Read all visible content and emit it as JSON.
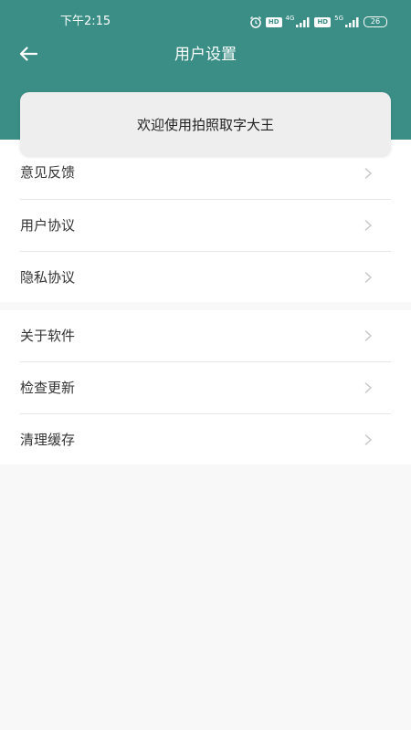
{
  "status_bar": {
    "time": "下午2:15",
    "network_4g": "4G",
    "network_5g": "5G",
    "hd_badge": "HD",
    "battery": "26",
    "icons": [
      "alarm-icon",
      "hd-icon",
      "signal-icon",
      "battery-icon"
    ]
  },
  "header": {
    "title": "用户设置",
    "back_icon": "back-arrow-icon",
    "background_color": "#3a8e86"
  },
  "welcome": {
    "text": "欢迎使用拍照取字大王"
  },
  "groups": [
    {
      "items": [
        {
          "label": "意见反馈"
        },
        {
          "label": "用户协议"
        },
        {
          "label": "隐私协议"
        }
      ]
    },
    {
      "items": [
        {
          "label": "关于软件"
        },
        {
          "label": "检查更新"
        },
        {
          "label": "清理缓存"
        }
      ]
    }
  ],
  "colors": {
    "primary": "#3a8e86",
    "page_background": "#f8f8f8",
    "card_background": "#efeeee",
    "text": "#333333",
    "chevron": "#c4c4c4"
  }
}
